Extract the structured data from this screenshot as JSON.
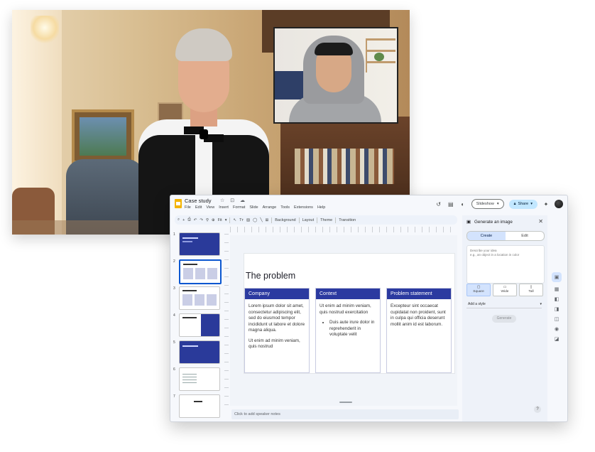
{
  "app": {
    "doc_title": "Case study",
    "menu": [
      "File",
      "Edit",
      "View",
      "Insert",
      "Format",
      "Slide",
      "Arrange",
      "Tools",
      "Extensions",
      "Help"
    ],
    "slideshow_label": "Slideshow",
    "share_label": "Share",
    "toolbar": {
      "zoom_label": "Fit",
      "background_label": "Background",
      "layout_label": "Layout",
      "theme_label": "Theme",
      "transition_label": "Transition"
    }
  },
  "filmstrip": {
    "slides": [
      {
        "num": "1",
        "style": "blue"
      },
      {
        "num": "2",
        "style": "columns",
        "selected": true
      },
      {
        "num": "3",
        "style": "columns"
      },
      {
        "num": "4",
        "style": "split"
      },
      {
        "num": "5",
        "style": "blue"
      },
      {
        "num": "6",
        "style": "lines"
      },
      {
        "num": "7",
        "style": "plain"
      }
    ]
  },
  "slide": {
    "title": "The problem",
    "columns": [
      {
        "heading": "Company",
        "paragraphs": [
          "Lorem ipsum dolor sit amet, consectetur adipiscing elit, sed do eiusmod tempor incididunt ut labore et dolore magna aliqua.",
          "Ut enim ad minim veniam, quis nostrud"
        ],
        "bullets": []
      },
      {
        "heading": "Context",
        "paragraphs": [
          "Ut enim ad minim veniam, quis nostrud exercitation"
        ],
        "bullets": [
          "Duis aute irure dolor in reprehenderit in voluptate velit"
        ]
      },
      {
        "heading": "Problem statement",
        "paragraphs": [
          "Excepteur sint occaecat cupidatat non proident, sunt in culpa qui officia deserunt mollit anim id est laborum."
        ],
        "bullets": []
      }
    ],
    "notes_placeholder": "Click to add speaker notes"
  },
  "panel": {
    "title": "Generate an image",
    "tab_create": "Create",
    "tab_edit": "Edit",
    "prompt_placeholder": "Describe your idea\ne.g., an object in a location in color",
    "ratios": [
      "Square",
      "Wide",
      "Tall"
    ],
    "style_label": "Add a style",
    "generate_label": "Generate"
  }
}
